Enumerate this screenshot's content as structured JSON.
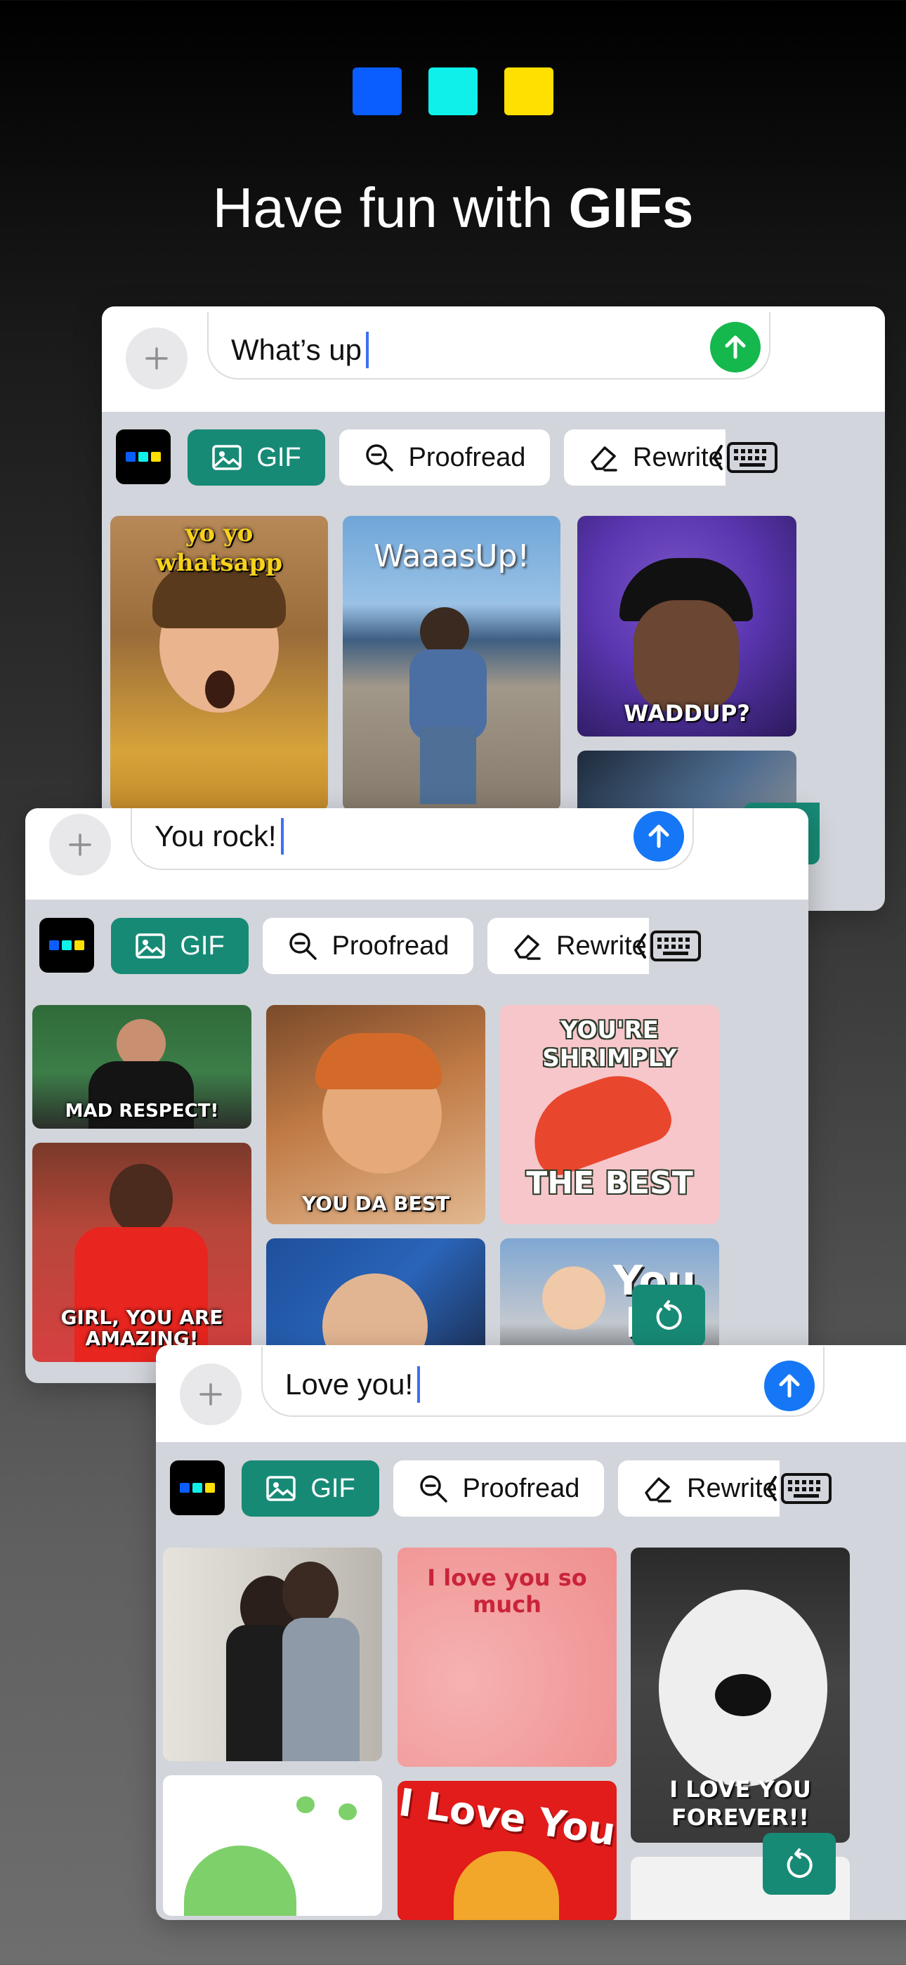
{
  "colors": {
    "blue": "#0a5dff",
    "cyan": "#0ff0ea",
    "yellow": "#ffe000",
    "accent_teal": "#178a76",
    "send_green": "#15b84d",
    "send_blue": "#1577f5"
  },
  "header": {
    "title_regular": "Have fun with ",
    "title_bold": "GIFs"
  },
  "toolbar": {
    "gif_label": "GIF",
    "proofread_label": "Proofread",
    "rewrite_label": "Rewrite"
  },
  "cards": [
    {
      "message": "What’s up",
      "send_icon": "arrow-up-icon",
      "gifs": [
        {
          "caption": "yo yo whatsapp"
        },
        {
          "caption": "WaaasUp!"
        },
        {
          "caption": "WADDUP?"
        }
      ]
    },
    {
      "message": "You rock!",
      "send_icon": "arrow-up-icon",
      "gifs": [
        {
          "caption": "MAD RESPECT!"
        },
        {
          "caption": "YOU DA BEST"
        },
        {
          "caption": "YOU'RE SHRIMPLY"
        },
        {
          "caption": "THE BEST"
        },
        {
          "caption": "GIRL, YOU ARE AMAZING!"
        },
        {
          "caption": "You Ro"
        }
      ]
    },
    {
      "message": "Love you!",
      "send_icon": "arrow-up-icon",
      "gifs": [
        {
          "caption": "I love you so much"
        },
        {
          "caption": "I LOVE YOU FOREVER!!"
        },
        {
          "caption": "I Love You"
        }
      ]
    }
  ]
}
